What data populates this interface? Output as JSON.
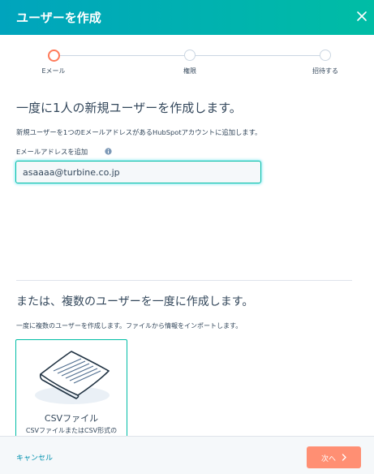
{
  "header": {
    "title": "ユーザーを作成",
    "close_icon": "close-icon",
    "gradient": [
      "#00a4bd",
      "#00bda5"
    ]
  },
  "stepper": {
    "current_step": 1,
    "steps": [
      {
        "label": "Eメール"
      },
      {
        "label": "権限"
      },
      {
        "label": "招待する"
      }
    ],
    "active_color": "#ff7a59"
  },
  "single": {
    "heading": "一度に1人の新規ユーザーを作成します。",
    "description": "新規ユーザーを1つのEメールアドレスがあるHubSpotアカウントに追加します。",
    "field_label": "Eメールアドレスを追加",
    "info_icon": "info-icon",
    "email_value": "asaaaa@turbine.co.jp"
  },
  "multiple": {
    "heading": "または、複数のユーザーを一度に作成します。",
    "description": "一度に複数のユーザーを作成します。ファイルから情報をインポートします。",
    "csv_card": {
      "icon": "csv-document-icon",
      "title": "CSVファイル",
      "description": "CSVファイルまたはCSV形式の"
    }
  },
  "footer": {
    "cancel_label": "キャンセル",
    "next_label": "次へ",
    "next_icon": "chevron-right-icon",
    "next_color": "#ff8f73"
  }
}
